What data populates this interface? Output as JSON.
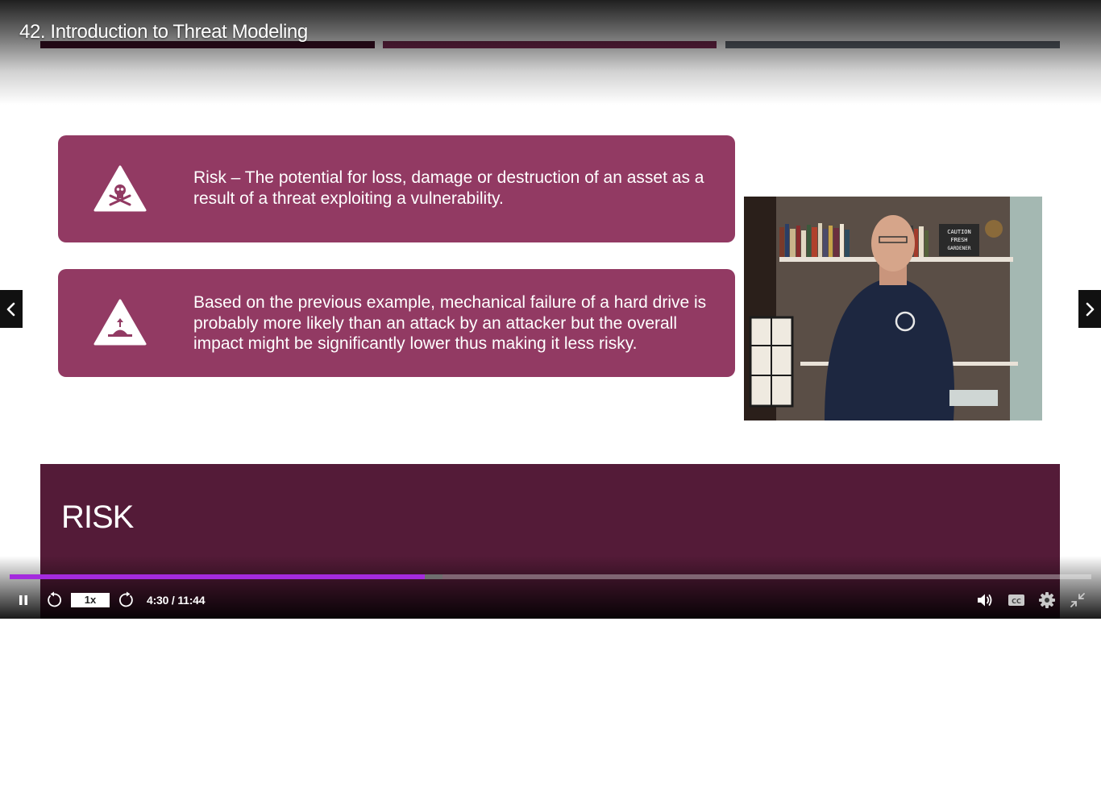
{
  "header": {
    "title": "42. Introduction to Threat Modeling"
  },
  "slide": {
    "top_bar_colors": [
      "#3d0f26",
      "#7a2a52",
      "#5f6670"
    ],
    "cards": [
      {
        "icon": "skull-warning-icon",
        "text": "Risk – The potential for loss, damage or destruction of an asset as a result of a threat exploiting a vulnerability."
      },
      {
        "icon": "warning-triangle-icon",
        "text": "Based on the previous example, mechanical failure of a hard drive is probably more likely than an attack by an attacker but the overall impact might be significantly lower thus making it less risky."
      }
    ],
    "banner_title": "RISK",
    "colors": {
      "card": "#923a63",
      "banner": "#541b38"
    }
  },
  "webcam": {
    "sign_text": "CAUTION FRESH GARDENER"
  },
  "controls": {
    "speed": "1x",
    "current_time": "4:30",
    "separator": " / ",
    "duration": "11:44",
    "progress_fraction": 0.384,
    "buffered_fraction": 0.4,
    "progress_color": "#a42bdd",
    "icons": [
      "pause-icon",
      "rewind-icon",
      "forward-icon",
      "volume-icon",
      "captions-icon",
      "settings-icon",
      "exit-fullscreen-icon"
    ]
  },
  "nav": {
    "prev_icon": "chevron-left-icon",
    "next_icon": "chevron-right-icon"
  }
}
